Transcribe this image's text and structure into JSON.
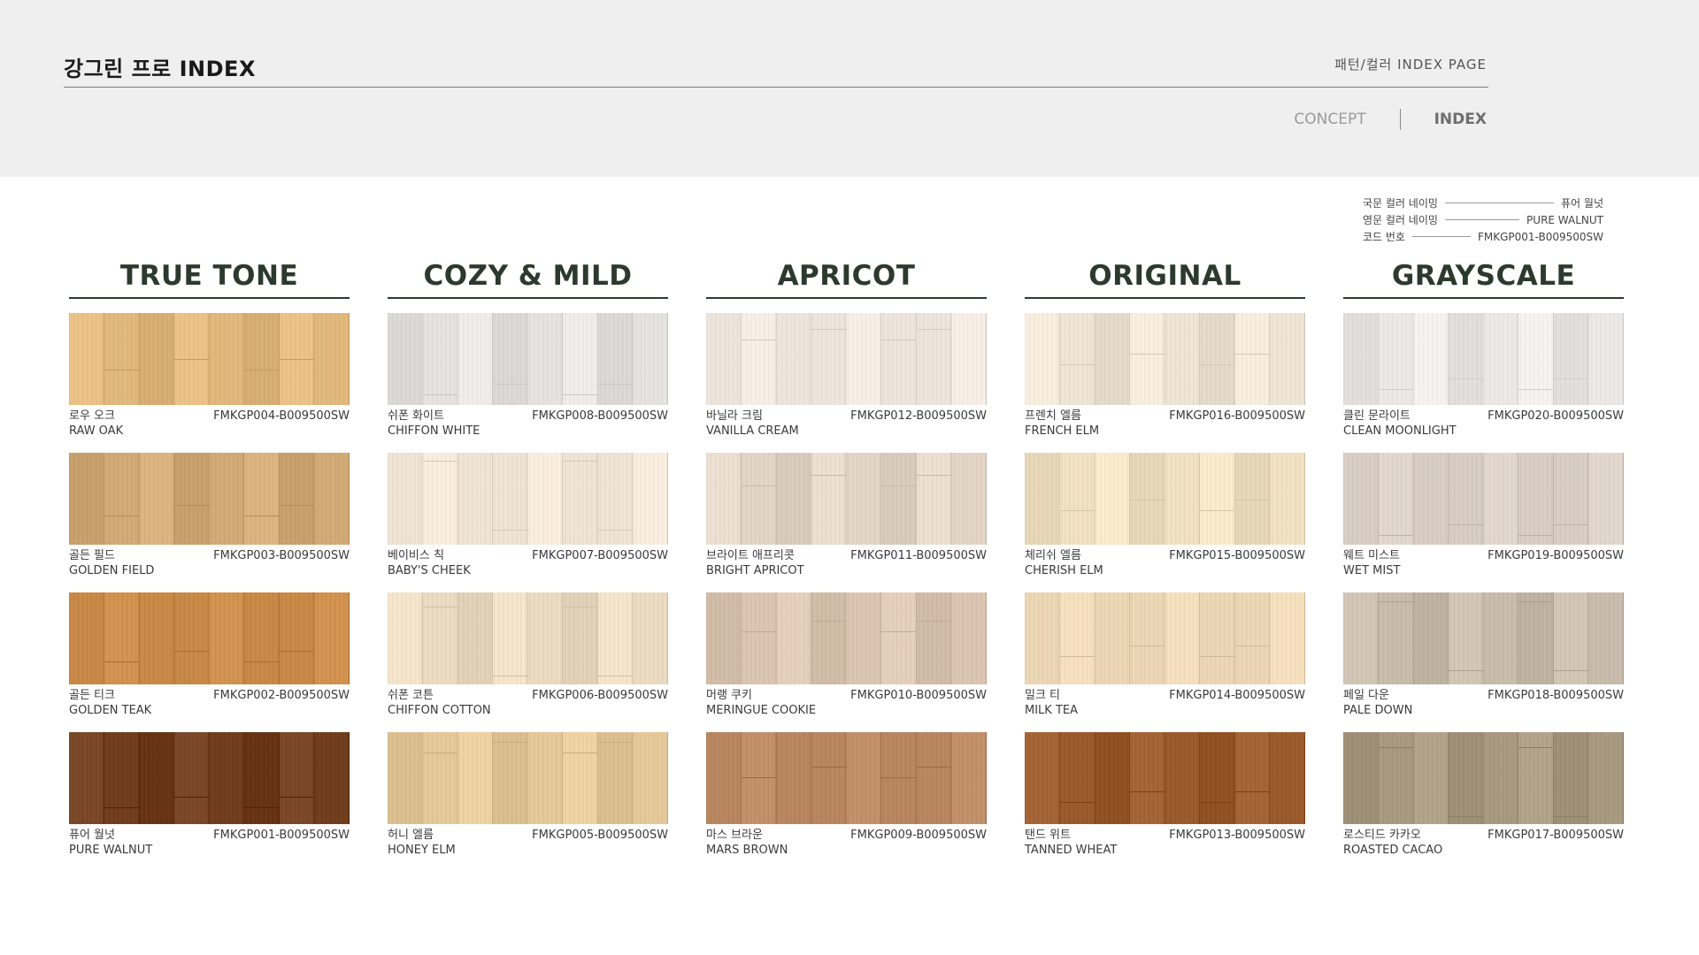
{
  "header": {
    "title": "강그린 프로 INDEX",
    "page_label": "패턴/컬러 INDEX PAGE",
    "nav": {
      "concept": "CONCEPT",
      "index": "INDEX"
    }
  },
  "legend": {
    "rows": [
      {
        "key": "국문 컬러 네이밍",
        "value": "퓨어 월넛"
      },
      {
        "key": "영문 컬러 네이밍",
        "value": "PURE WALNUT"
      },
      {
        "key": "코드 번호",
        "value": "FMKGP001-B009500SW"
      }
    ]
  },
  "columns": [
    {
      "title": "TRUE TONE",
      "items": [
        {
          "kr": "로우 오크",
          "en": "RAW OAK",
          "code": "FMKGP004-B009500SW",
          "color": "#e2b87c"
        },
        {
          "kr": "골든 필드",
          "en": "GOLDEN FIELD",
          "code": "FMKGP003-B009500SW",
          "color": "#d2aa76"
        },
        {
          "kr": "골든 티크",
          "en": "GOLDEN TEAK",
          "code": "FMKGP002-B009500SW",
          "color": "#c98845"
        },
        {
          "kr": "퓨어 월넛",
          "en": "PURE WALNUT",
          "code": "FMKGP001-B009500SW",
          "color": "#6f3c1c"
        }
      ]
    },
    {
      "title": "COZY & MILD",
      "items": [
        {
          "kr": "쉬폰 화이트",
          "en": "CHIFFON WHITE",
          "code": "FMKGP008-B009500SW",
          "color": "#e6e4e1"
        },
        {
          "kr": "베이비스 칙",
          "en": "BABY'S CHEEK",
          "code": "FMKGP007-B009500SW",
          "color": "#f0e4d6"
        },
        {
          "kr": "쉬폰 코튼",
          "en": "CHIFFON COTTON",
          "code": "FMKGP006-B009500SW",
          "color": "#ebdcc2"
        },
        {
          "kr": "허니 엘름",
          "en": "HONEY ELM",
          "code": "FMKGP005-B009500SW",
          "color": "#e6c99a"
        }
      ]
    },
    {
      "title": "APRICOT",
      "items": [
        {
          "kr": "바닐라 크림",
          "en": "VANILLA CREAM",
          "code": "FMKGP012-B009500SW",
          "color": "#eee6dc"
        },
        {
          "kr": "브라이트 애프리콧",
          "en": "BRIGHT APRICOT",
          "code": "FMKGP011-B009500SW",
          "color": "#e3d6c8"
        },
        {
          "kr": "머랭 쿠키",
          "en": "MERINGUE COOKIE",
          "code": "FMKGP010-B009500SW",
          "color": "#dcc6b2"
        },
        {
          "kr": "마스 브라운",
          "en": "MARS BROWN",
          "code": "FMKGP009-B009500SW",
          "color": "#b88660"
        }
      ]
    },
    {
      "title": "ORIGINAL",
      "items": [
        {
          "kr": "프렌치 엘름",
          "en": "FRENCH ELM",
          "code": "FMKGP016-B009500SW",
          "color": "#efe5d6"
        },
        {
          "kr": "체리쉬 엘름",
          "en": "CHERISH ELM",
          "code": "FMKGP015-B009500SW",
          "color": "#f1e2c2"
        },
        {
          "kr": "밀크 티",
          "en": "MILK TEA",
          "code": "FMKGP014-B009500SW",
          "color": "#ecd7b4"
        },
        {
          "kr": "탠드 위트",
          "en": "TANNED WHEAT",
          "code": "FMKGP013-B009500SW",
          "color": "#9a5a2a"
        }
      ]
    },
    {
      "title": "GRAYSCALE",
      "items": [
        {
          "kr": "클린 문라이트",
          "en": "CLEAN MOONLIGHT",
          "code": "FMKGP020-B009500SW",
          "color": "#eceae8"
        },
        {
          "kr": "웨트 미스트",
          "en": "WET MIST",
          "code": "FMKGP019-B009500SW",
          "color": "#d8cec4"
        },
        {
          "kr": "페일 다운",
          "en": "PALE DOWN",
          "code": "FMKGP018-B009500SW",
          "color": "#c9bcae"
        },
        {
          "kr": "로스티드 카카오",
          "en": "ROASTED CACAO",
          "code": "FMKGP017-B009500SW",
          "color": "#a89a80"
        }
      ]
    }
  ]
}
